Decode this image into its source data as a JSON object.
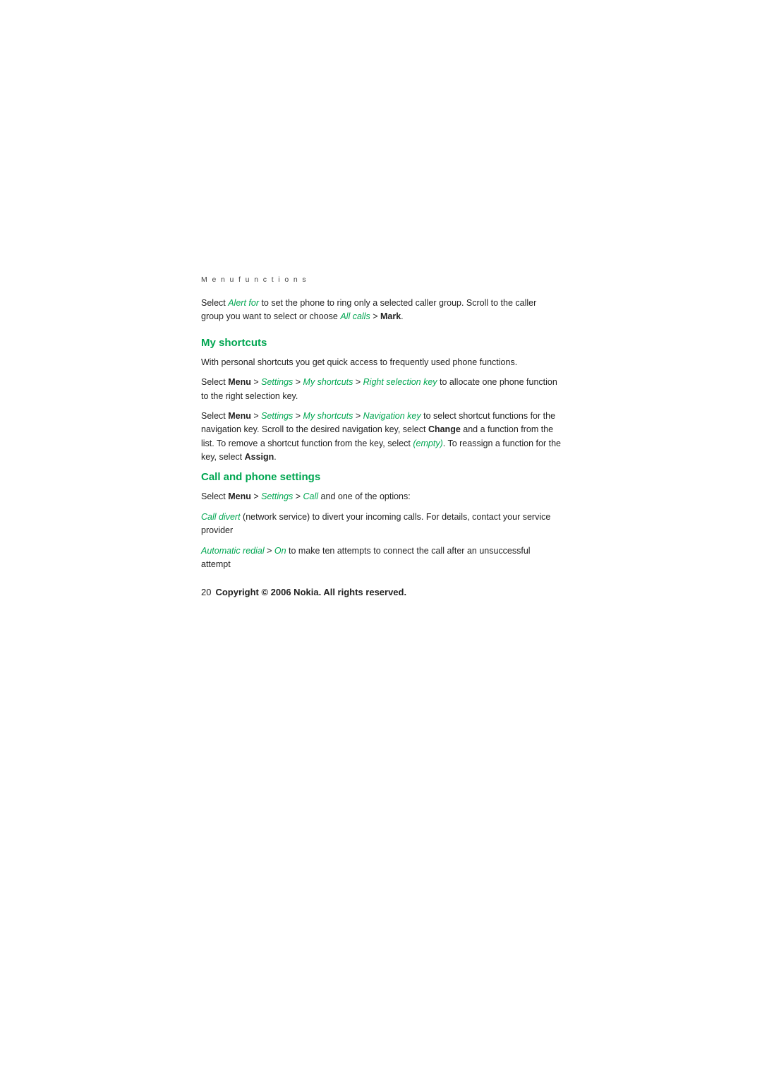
{
  "page": {
    "menu_functions_label": "M e n u   f u n c t i o n s",
    "intro_text_1": "Select ",
    "alert_for_link": "Alert for",
    "intro_text_2": " to set the phone to ring only a selected caller group. Scroll to the caller group you want to select or choose ",
    "all_calls_link": "All calls",
    "intro_text_3": " > ",
    "mark_bold": "Mark",
    "intro_text_end": ".",
    "my_shortcuts": {
      "heading": "My shortcuts",
      "para1": "With personal shortcuts you get quick access to frequently used phone functions.",
      "para2_prefix": "Select ",
      "para2_menu": "Menu",
      "para2_mid1": " > ",
      "para2_settings": "Settings",
      "para2_mid2": " > ",
      "para2_myshortcuts": "My shortcuts",
      "para2_mid3": " > ",
      "para2_rightkey": "Right selection key",
      "para2_suffix": " to allocate one phone function to the right selection key.",
      "para3_prefix": "Select ",
      "para3_menu": "Menu",
      "para3_mid1": " > ",
      "para3_settings": "Settings",
      "para3_mid2": " > ",
      "para3_myshortcuts": "My shortcuts",
      "para3_mid3": " > ",
      "para3_navkey": "Navigation key",
      "para3_text1": " to select shortcut functions for the navigation key. Scroll to the desired navigation key, select ",
      "para3_change": "Change",
      "para3_text2": " and a function from the list. To remove a shortcut function from the key, select ",
      "para3_empty": "(empty)",
      "para3_text3": ". To reassign a function for the key, select ",
      "para3_assign": "Assign",
      "para3_end": "."
    },
    "call_phone_settings": {
      "heading": "Call and phone settings",
      "para1_prefix": "Select ",
      "para1_menu": "Menu",
      "para1_mid1": " > ",
      "para1_settings": "Settings",
      "para1_mid2": " > ",
      "para1_call": "Call",
      "para1_suffix": " and one of the options:",
      "para2_calldivert": "Call divert",
      "para2_text": " (network service) to divert your incoming calls. For details, contact your service provider",
      "para3_autoreial": "Automatic redial",
      "para3_mid": " > ",
      "para3_on": "On",
      "para3_text": " to make ten attempts to connect the call after an unsuccessful attempt"
    },
    "footer": {
      "page_number": "20",
      "copyright_text": "Copyright © 2006 Nokia. All rights reserved."
    }
  }
}
